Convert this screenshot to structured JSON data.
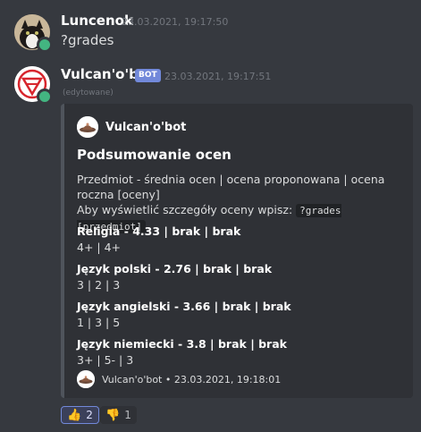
{
  "messages": [
    {
      "username": "Luncenok",
      "timestamp": "23.03.2021, 19:17:50",
      "content": "?grades",
      "status_color": "#43b581"
    },
    {
      "username": "Vulcan'o'bot",
      "bot_tag": "BOT",
      "timestamp": "23.03.2021, 19:17:51",
      "edited": "(edytowane)",
      "status_color": "#43b581"
    }
  ],
  "embed": {
    "author": "Vulcan'o'bot",
    "title": "Podsumowanie ocen",
    "description_line1": "Przedmiot - średnia ocen | ocena proponowana | ocena roczna [oceny]",
    "description_line2": "Aby wyświetlić szczegóły oceny wpisz: ",
    "description_code": "?grades [przedmiot]",
    "fields": [
      {
        "name": "Religia - 4.33 | brak | brak",
        "value": "4+ | 4+"
      },
      {
        "name": "Język polski - 2.76 | brak | brak",
        "value": "3 | 2 | 3"
      },
      {
        "name": "Język angielski - 3.66 | brak | brak",
        "value": "1 | 3 | 5"
      },
      {
        "name": "Język niemiecki - 3.8 | brak | brak",
        "value": "3+ | 5- | 3"
      }
    ],
    "footer": "Vulcan'o'bot • 23.03.2021, 19:18:01"
  },
  "reactions": [
    {
      "emoji": "👍",
      "icon": "thumbs-up-icon",
      "count": "2",
      "active": true
    },
    {
      "emoji": "👎",
      "icon": "thumbs-down-icon",
      "count": "1",
      "active": false
    }
  ]
}
